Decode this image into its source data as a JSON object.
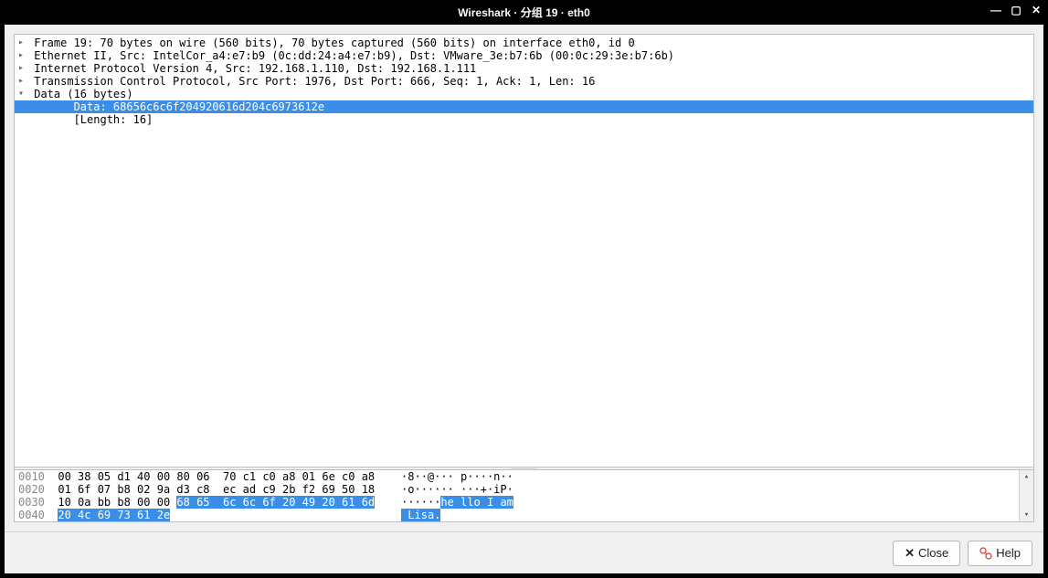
{
  "titlebar": {
    "title": "Wireshark · 分组 19 · eth0"
  },
  "detail": {
    "rows": [
      {
        "arrow": "right",
        "indent": 0,
        "text": "Frame 19: 70 bytes on wire (560 bits), 70 bytes captured (560 bits) on interface eth0, id 0",
        "sel": false
      },
      {
        "arrow": "right",
        "indent": 0,
        "text": "Ethernet II, Src: IntelCor_a4:e7:b9 (0c:dd:24:a4:e7:b9), Dst: VMware_3e:b7:6b (00:0c:29:3e:b7:6b)",
        "sel": false
      },
      {
        "arrow": "right",
        "indent": 0,
        "text": "Internet Protocol Version 4, Src: 192.168.1.110, Dst: 192.168.1.111",
        "sel": false
      },
      {
        "arrow": "right",
        "indent": 0,
        "text": "Transmission Control Protocol, Src Port: 1976, Dst Port: 666, Seq: 1, Ack: 1, Len: 16",
        "sel": false
      },
      {
        "arrow": "down",
        "indent": 0,
        "text": "Data (16 bytes)",
        "sel": false
      },
      {
        "arrow": "",
        "indent": 2,
        "text": "Data: 68656c6c6f204920616d204c6973612e",
        "sel": true
      },
      {
        "arrow": "",
        "indent": 2,
        "text": "[Length: 16]",
        "sel": false
      }
    ]
  },
  "hex": {
    "rows": [
      {
        "offset": "0010",
        "segs": [
          {
            "t": "  00 38 05 d1 40 00 80 06  70 c1 c0 a8 01 6e c0 a8   ",
            "hl": false
          },
          {
            "t": " ·8··@··· p····n··",
            "hl": false
          }
        ]
      },
      {
        "offset": "0020",
        "segs": [
          {
            "t": "  01 6f 07 b8 02 9a d3 c8  ec ad c9 2b f2 69 50 18   ",
            "hl": false
          },
          {
            "t": " ·o······ ···+·iP·",
            "hl": false
          }
        ]
      },
      {
        "offset": "0030",
        "segs": [
          {
            "t": "  10 0a bb b8 00 00 ",
            "hl": false
          },
          {
            "t": "68 65  6c 6c 6f 20 49 20 61 6d",
            "hl": true
          },
          {
            "t": "   ",
            "hl": false
          },
          {
            "t": " ······",
            "hl": false
          },
          {
            "t": "he llo I am",
            "hl": true
          }
        ]
      },
      {
        "offset": "0040",
        "segs": [
          {
            "t": "  ",
            "hl": false
          },
          {
            "t": "20 4c 69 73 61 2e",
            "hl": true
          },
          {
            "t": "                                  ",
            "hl": false
          },
          {
            "t": " ",
            "hl": false
          },
          {
            "t": " Lisa.",
            "hl": true
          }
        ]
      }
    ]
  },
  "footer": {
    "close_label": "Close",
    "help_label": "Help"
  }
}
